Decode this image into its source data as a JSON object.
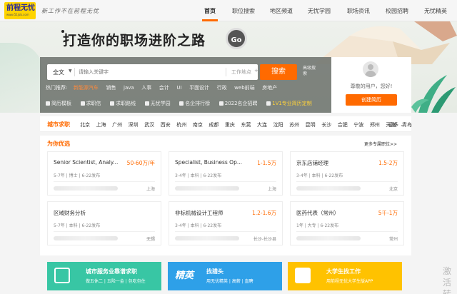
{
  "brand": {
    "logo_text": "前程无忧",
    "logo_url": "www.51job.com",
    "slogan": "新工作不在前程无忧"
  },
  "nav": {
    "items": [
      "首页",
      "职位搜索",
      "地区频道",
      "无忧学园",
      "职场资讯",
      "校园招聘",
      "无忧精英"
    ],
    "active": "首页"
  },
  "hero": {
    "title": "打造你的职场进阶之路",
    "go_label": "Go"
  },
  "search": {
    "scope": "全文",
    "placeholder": "请输入关键字",
    "location_placeholder": "工作地点",
    "button": "搜索",
    "advanced": "高级搜索"
  },
  "hot": {
    "label": "热门推荐:",
    "items": [
      "新能源汽车",
      "销售",
      "java",
      "人事",
      "会计",
      "UI",
      "平面设计",
      "行政",
      "web前端",
      "房地产"
    ]
  },
  "quick": {
    "items": [
      "简历模板",
      "求职信",
      "求职路线",
      "无忧学园",
      "名企排行榜",
      "2022名企招聘",
      "1V1专业简历定制"
    ]
  },
  "user": {
    "greeting": "尊敬的用户，您好!",
    "create_button": "创建简历"
  },
  "city": {
    "title": "城市求职",
    "list": [
      "北京",
      "上海",
      "广州",
      "深圳",
      "武汉",
      "西安",
      "杭州",
      "南京",
      "成都",
      "重庆",
      "东莞",
      "大连",
      "沈阳",
      "苏州",
      "昆明",
      "长沙",
      "合肥",
      "宁波",
      "郑州",
      "天津",
      "青岛"
    ],
    "more": "更多"
  },
  "recommend": {
    "title": "为你优选",
    "more": "更多专属职位>>",
    "jobs": [
      {
        "title": "Senior Scientist, Analy...",
        "salary": "50-60万/年",
        "meta": "5-7年 | 博士 | 6-22发布",
        "city": "上海"
      },
      {
        "title": "Specialist, Business Op...",
        "salary": "1-1.5万",
        "meta": "3-4年 | 本科 | 6-22发布",
        "city": "上海"
      },
      {
        "title": "京东店铺经理",
        "salary": "1.5-2万",
        "meta": "3-4年 | 本科 | 6-22发布",
        "city": "北京"
      },
      {
        "title": "区域财务分析",
        "salary": "",
        "meta": "5-7年 | 本科 | 6-22发布",
        "city": "无锡"
      },
      {
        "title": "非标机械设计工程师",
        "salary": "1.2-1.6万",
        "meta": "3-4年 | 本科 | 6-22发布",
        "city": "长沙-长沙县"
      },
      {
        "title": "医药代表（常州）",
        "salary": "5千-1万",
        "meta": "1年 | 大专 | 6-22发布",
        "city": "常州"
      }
    ]
  },
  "banners": [
    {
      "title": "城市服务业靠谱求职",
      "sub": "做五休二 | 五险一金 | 包吃包住",
      "color": "#38c6a4"
    },
    {
      "title": "找猎头",
      "sub": "用无忧精英 | 高薪 | 直聘",
      "logo": "精英",
      "color": "#2ea0e8"
    },
    {
      "title": "大学生找工作",
      "sub": "用前程无忧大学生版APP",
      "color": "#ffc200"
    }
  ],
  "watermark": "激活转"
}
